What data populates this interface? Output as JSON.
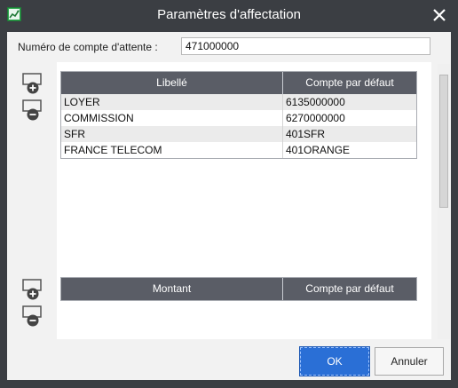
{
  "window": {
    "title": "Paramètres d'affectation",
    "icon": "chart-app-icon",
    "close_icon": "close-icon"
  },
  "account": {
    "label": "Numéro de compte d'attente :",
    "value": "471000000"
  },
  "top_table": {
    "columns": [
      "Libellé",
      "Compte par défaut"
    ],
    "rows": [
      [
        "LOYER",
        "6135000000"
      ],
      [
        "COMMISSION",
        "6270000000"
      ],
      [
        "SFR",
        "401SFR"
      ],
      [
        "FRANCE TELECOM",
        "401ORANGE"
      ]
    ]
  },
  "bottom_table": {
    "columns": [
      "Montant",
      "Compte par défaut"
    ],
    "rows": []
  },
  "buttons": {
    "ok": "OK",
    "cancel": "Annuler"
  },
  "colors": {
    "titlebar": "#3b3e43",
    "table_header": "#5a5d66",
    "ok_button": "#2a6fd6",
    "icon_green": "#2fa84f"
  }
}
